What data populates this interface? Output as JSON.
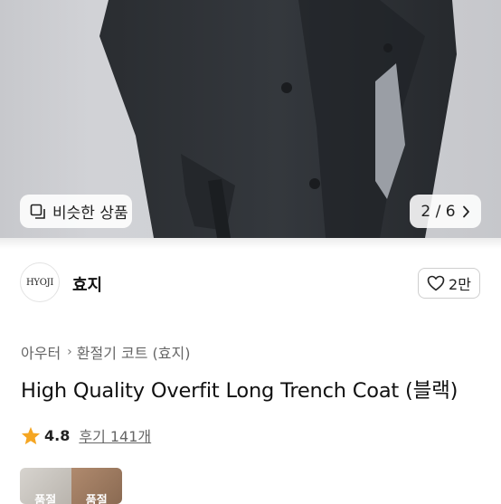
{
  "similar_chip": {
    "label": "비슷한 상품",
    "icon": "similar-items-icon"
  },
  "pager": {
    "text": "2 / 6",
    "icon": "chevron-right-icon"
  },
  "store": {
    "logo_text": "HYOJI",
    "name": "효지"
  },
  "like": {
    "count": "2만",
    "icon": "heart-outline-icon"
  },
  "breadcrumb": {
    "items": [
      "아우터",
      "환절기 코트 (효지)"
    ]
  },
  "product": {
    "title": "High Quality Overfit Long Trench Coat (블랙)"
  },
  "rating": {
    "score": "4.8",
    "reviews": "후기 141개",
    "star_color": "#F5A623"
  },
  "thumbnails": {
    "labels": [
      "품절",
      "품절"
    ]
  }
}
